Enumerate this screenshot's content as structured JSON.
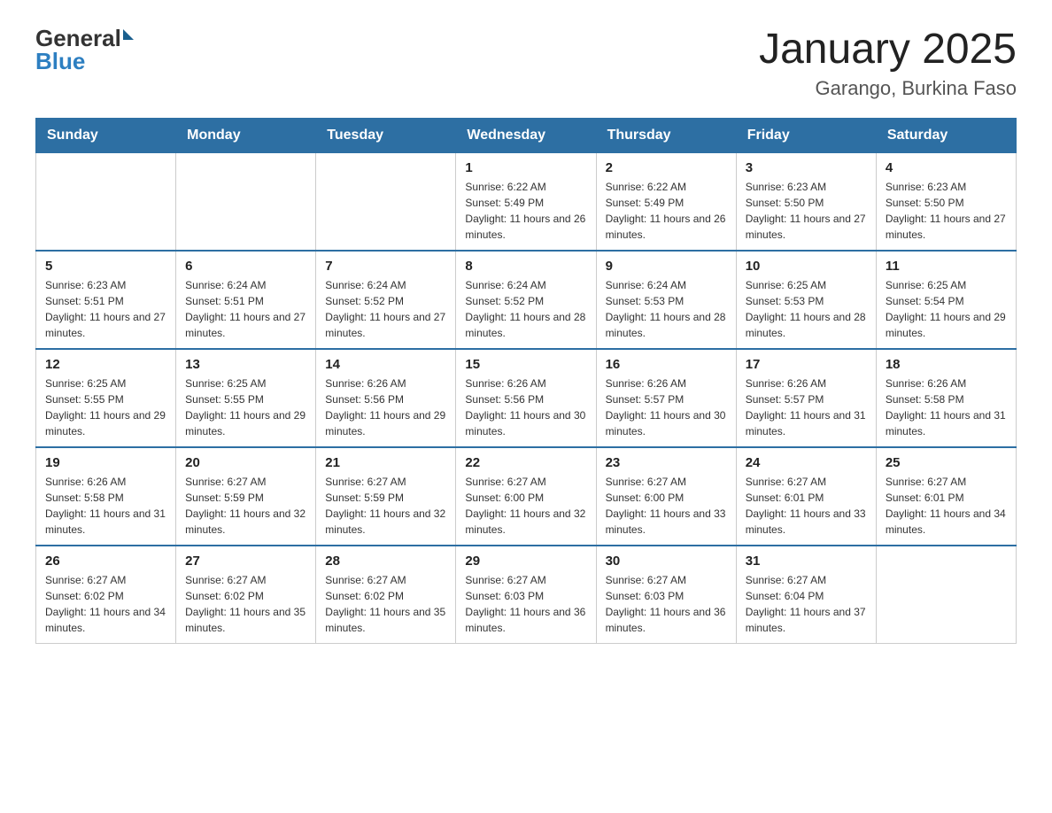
{
  "header": {
    "logo_general": "General",
    "logo_blue": "Blue",
    "title": "January 2025",
    "subtitle": "Garango, Burkina Faso"
  },
  "days_of_week": [
    "Sunday",
    "Monday",
    "Tuesday",
    "Wednesday",
    "Thursday",
    "Friday",
    "Saturday"
  ],
  "weeks": [
    [
      {
        "day": "",
        "info": ""
      },
      {
        "day": "",
        "info": ""
      },
      {
        "day": "",
        "info": ""
      },
      {
        "day": "1",
        "info": "Sunrise: 6:22 AM\nSunset: 5:49 PM\nDaylight: 11 hours and 26 minutes."
      },
      {
        "day": "2",
        "info": "Sunrise: 6:22 AM\nSunset: 5:49 PM\nDaylight: 11 hours and 26 minutes."
      },
      {
        "day": "3",
        "info": "Sunrise: 6:23 AM\nSunset: 5:50 PM\nDaylight: 11 hours and 27 minutes."
      },
      {
        "day": "4",
        "info": "Sunrise: 6:23 AM\nSunset: 5:50 PM\nDaylight: 11 hours and 27 minutes."
      }
    ],
    [
      {
        "day": "5",
        "info": "Sunrise: 6:23 AM\nSunset: 5:51 PM\nDaylight: 11 hours and 27 minutes."
      },
      {
        "day": "6",
        "info": "Sunrise: 6:24 AM\nSunset: 5:51 PM\nDaylight: 11 hours and 27 minutes."
      },
      {
        "day": "7",
        "info": "Sunrise: 6:24 AM\nSunset: 5:52 PM\nDaylight: 11 hours and 27 minutes."
      },
      {
        "day": "8",
        "info": "Sunrise: 6:24 AM\nSunset: 5:52 PM\nDaylight: 11 hours and 28 minutes."
      },
      {
        "day": "9",
        "info": "Sunrise: 6:24 AM\nSunset: 5:53 PM\nDaylight: 11 hours and 28 minutes."
      },
      {
        "day": "10",
        "info": "Sunrise: 6:25 AM\nSunset: 5:53 PM\nDaylight: 11 hours and 28 minutes."
      },
      {
        "day": "11",
        "info": "Sunrise: 6:25 AM\nSunset: 5:54 PM\nDaylight: 11 hours and 29 minutes."
      }
    ],
    [
      {
        "day": "12",
        "info": "Sunrise: 6:25 AM\nSunset: 5:55 PM\nDaylight: 11 hours and 29 minutes."
      },
      {
        "day": "13",
        "info": "Sunrise: 6:25 AM\nSunset: 5:55 PM\nDaylight: 11 hours and 29 minutes."
      },
      {
        "day": "14",
        "info": "Sunrise: 6:26 AM\nSunset: 5:56 PM\nDaylight: 11 hours and 29 minutes."
      },
      {
        "day": "15",
        "info": "Sunrise: 6:26 AM\nSunset: 5:56 PM\nDaylight: 11 hours and 30 minutes."
      },
      {
        "day": "16",
        "info": "Sunrise: 6:26 AM\nSunset: 5:57 PM\nDaylight: 11 hours and 30 minutes."
      },
      {
        "day": "17",
        "info": "Sunrise: 6:26 AM\nSunset: 5:57 PM\nDaylight: 11 hours and 31 minutes."
      },
      {
        "day": "18",
        "info": "Sunrise: 6:26 AM\nSunset: 5:58 PM\nDaylight: 11 hours and 31 minutes."
      }
    ],
    [
      {
        "day": "19",
        "info": "Sunrise: 6:26 AM\nSunset: 5:58 PM\nDaylight: 11 hours and 31 minutes."
      },
      {
        "day": "20",
        "info": "Sunrise: 6:27 AM\nSunset: 5:59 PM\nDaylight: 11 hours and 32 minutes."
      },
      {
        "day": "21",
        "info": "Sunrise: 6:27 AM\nSunset: 5:59 PM\nDaylight: 11 hours and 32 minutes."
      },
      {
        "day": "22",
        "info": "Sunrise: 6:27 AM\nSunset: 6:00 PM\nDaylight: 11 hours and 32 minutes."
      },
      {
        "day": "23",
        "info": "Sunrise: 6:27 AM\nSunset: 6:00 PM\nDaylight: 11 hours and 33 minutes."
      },
      {
        "day": "24",
        "info": "Sunrise: 6:27 AM\nSunset: 6:01 PM\nDaylight: 11 hours and 33 minutes."
      },
      {
        "day": "25",
        "info": "Sunrise: 6:27 AM\nSunset: 6:01 PM\nDaylight: 11 hours and 34 minutes."
      }
    ],
    [
      {
        "day": "26",
        "info": "Sunrise: 6:27 AM\nSunset: 6:02 PM\nDaylight: 11 hours and 34 minutes."
      },
      {
        "day": "27",
        "info": "Sunrise: 6:27 AM\nSunset: 6:02 PM\nDaylight: 11 hours and 35 minutes."
      },
      {
        "day": "28",
        "info": "Sunrise: 6:27 AM\nSunset: 6:02 PM\nDaylight: 11 hours and 35 minutes."
      },
      {
        "day": "29",
        "info": "Sunrise: 6:27 AM\nSunset: 6:03 PM\nDaylight: 11 hours and 36 minutes."
      },
      {
        "day": "30",
        "info": "Sunrise: 6:27 AM\nSunset: 6:03 PM\nDaylight: 11 hours and 36 minutes."
      },
      {
        "day": "31",
        "info": "Sunrise: 6:27 AM\nSunset: 6:04 PM\nDaylight: 11 hours and 37 minutes."
      },
      {
        "day": "",
        "info": ""
      }
    ]
  ]
}
